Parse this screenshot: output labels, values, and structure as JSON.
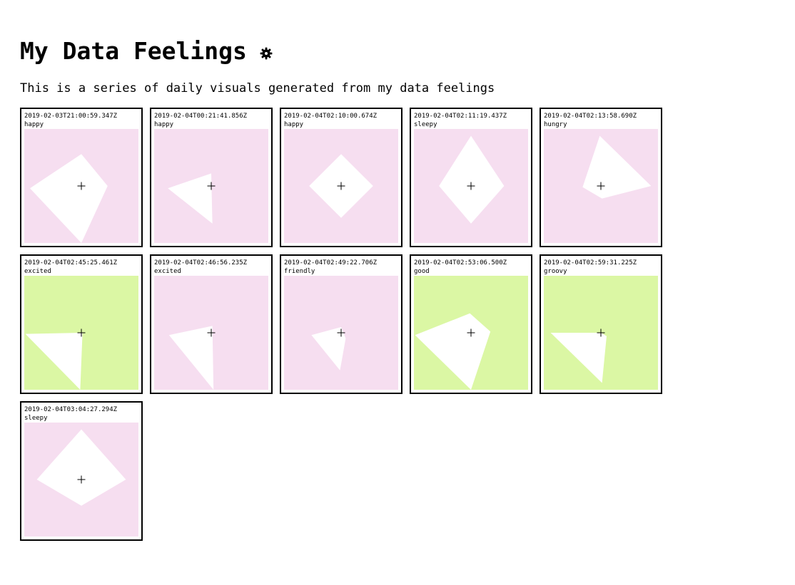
{
  "page": {
    "title": "My Data Feelings",
    "title_icon": "gear-icon",
    "subtitle": "This is a series of daily visuals generated from my data feelings"
  },
  "colors": {
    "pink": "#f6def0",
    "green": "#dbf7a4",
    "shape": "#ffffff",
    "border": "#000000"
  },
  "entries": [
    {
      "timestamp": "2019-02-03T21:00:59.347Z",
      "feeling": "happy",
      "bg": "pink",
      "shape": [
        [
          0.5,
          0.22
        ],
        [
          0.73,
          0.5
        ],
        [
          0.5,
          1.0
        ],
        [
          0.05,
          0.52
        ]
      ]
    },
    {
      "timestamp": "2019-02-04T00:21:41.856Z",
      "feeling": "happy",
      "bg": "pink",
      "shape": [
        [
          0.5,
          0.39
        ],
        [
          0.51,
          0.83
        ],
        [
          0.12,
          0.52
        ]
      ]
    },
    {
      "timestamp": "2019-02-04T02:10:00.674Z",
      "feeling": "happy",
      "bg": "pink",
      "shape": [
        [
          0.5,
          0.22
        ],
        [
          0.78,
          0.5
        ],
        [
          0.5,
          0.78
        ],
        [
          0.22,
          0.5
        ]
      ]
    },
    {
      "timestamp": "2019-02-04T02:11:19.437Z",
      "feeling": "sleepy",
      "bg": "pink",
      "shape": [
        [
          0.5,
          0.06
        ],
        [
          0.79,
          0.5
        ],
        [
          0.5,
          0.83
        ],
        [
          0.22,
          0.5
        ]
      ]
    },
    {
      "timestamp": "2019-02-04T02:13:58.690Z",
      "feeling": "hungry",
      "bg": "pink",
      "shape": [
        [
          0.49,
          0.06
        ],
        [
          0.94,
          0.5
        ],
        [
          0.51,
          0.61
        ],
        [
          0.34,
          0.51
        ]
      ]
    },
    {
      "timestamp": "2019-02-04T02:45:25.461Z",
      "feeling": "excited",
      "bg": "green",
      "shape": [
        [
          0.51,
          0.5
        ],
        [
          0.49,
          1.0
        ],
        [
          0.01,
          0.51
        ]
      ]
    },
    {
      "timestamp": "2019-02-04T02:46:56.235Z",
      "feeling": "excited",
      "bg": "green_off_pink",
      "shape": [
        [
          0.51,
          0.44
        ],
        [
          0.52,
          1.0
        ],
        [
          0.13,
          0.52
        ]
      ]
    },
    {
      "timestamp": "2019-02-04T02:49:22.706Z",
      "feeling": "friendly",
      "bg": "pink",
      "shape": [
        [
          0.5,
          0.45
        ],
        [
          0.54,
          0.55
        ],
        [
          0.49,
          0.83
        ],
        [
          0.24,
          0.52
        ]
      ]
    },
    {
      "timestamp": "2019-02-04T02:53:06.500Z",
      "feeling": "good",
      "bg": "green",
      "shape": [
        [
          0.49,
          0.33
        ],
        [
          0.67,
          0.49
        ],
        [
          0.5,
          1.0
        ],
        [
          0.01,
          0.52
        ]
      ]
    },
    {
      "timestamp": "2019-02-04T02:59:31.225Z",
      "feeling": "groovy",
      "bg": "green",
      "shape": [
        [
          0.5,
          0.5
        ],
        [
          0.55,
          0.53
        ],
        [
          0.51,
          0.94
        ],
        [
          0.06,
          0.5
        ]
      ]
    },
    {
      "timestamp": "2019-02-04T03:04:27.294Z",
      "feeling": "sleepy",
      "bg": "pink",
      "shape": [
        [
          0.5,
          0.06
        ],
        [
          0.89,
          0.5
        ],
        [
          0.5,
          0.73
        ],
        [
          0.11,
          0.5
        ]
      ]
    }
  ]
}
